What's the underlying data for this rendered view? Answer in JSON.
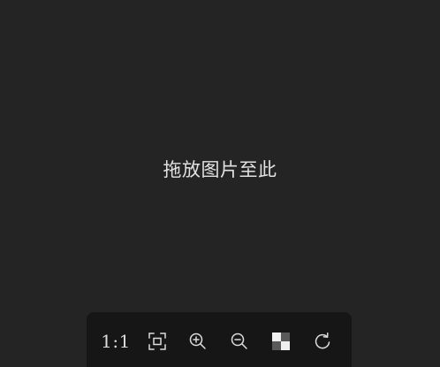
{
  "drop_zone": {
    "hint": "拖放图片至此"
  },
  "toolbar": {
    "actual_size_label": "1:1",
    "tools": [
      {
        "id": "actual-size",
        "icon": "text-1-1"
      },
      {
        "id": "fit-to-window",
        "icon": "fit-screen-icon"
      },
      {
        "id": "zoom-in",
        "icon": "zoom-in-icon"
      },
      {
        "id": "zoom-out",
        "icon": "zoom-out-icon"
      },
      {
        "id": "transparency-background",
        "icon": "checkerboard-icon"
      },
      {
        "id": "rotate",
        "icon": "rotate-clockwise-icon"
      }
    ]
  },
  "colors": {
    "background": "#242424",
    "toolbar_background": "#161616",
    "foreground": "#dcdcdc"
  }
}
